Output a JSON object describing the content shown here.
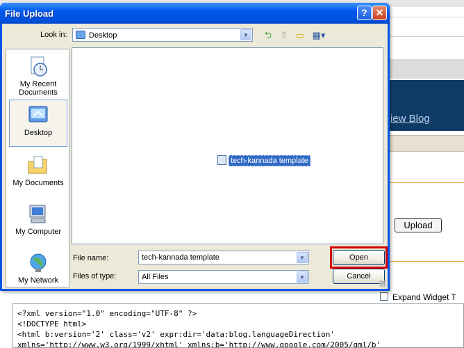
{
  "dialog": {
    "title": "File Upload",
    "help_glyph": "?",
    "close_glyph": "✕",
    "look_in_label": "Look in:",
    "look_in_value": "Desktop",
    "places": [
      {
        "label": "My Recent Documents",
        "icon": "recent-documents-icon"
      },
      {
        "label": "Desktop",
        "icon": "desktop-icon"
      },
      {
        "label": "My Documents",
        "icon": "my-documents-icon"
      },
      {
        "label": "My Computer",
        "icon": "my-computer-icon"
      },
      {
        "label": "My Network",
        "icon": "my-network-icon"
      }
    ],
    "files": [
      {
        "name": "tech-kannada template",
        "selected": true
      }
    ],
    "file_name_label": "File name:",
    "file_name_value": "tech-kannada template",
    "file_type_label": "Files of type:",
    "file_type_value": "All Files",
    "open_label": "Open",
    "cancel_label": "Cancel"
  },
  "background": {
    "view_blog_link": "iew Blog",
    "upload_button": "Upload",
    "expand_widget_label": "Expand Widget T",
    "code_lines": [
      "<?xml version=\"1.0\" encoding=\"UTF-8\" ?>",
      "<!DOCTYPE html>",
      "<html b:version='2' class='v2' expr:dir='data:blog.languageDirection'",
      "xmlns='http://www.w3.org/1999/xhtml' xmlns:b='http://www.google.com/2005/gml/b'"
    ]
  },
  "colors": {
    "titlebar": "#0058ee",
    "selection": "#316ac5",
    "highlight_box": "#d40000",
    "client": "#ece9d8"
  }
}
